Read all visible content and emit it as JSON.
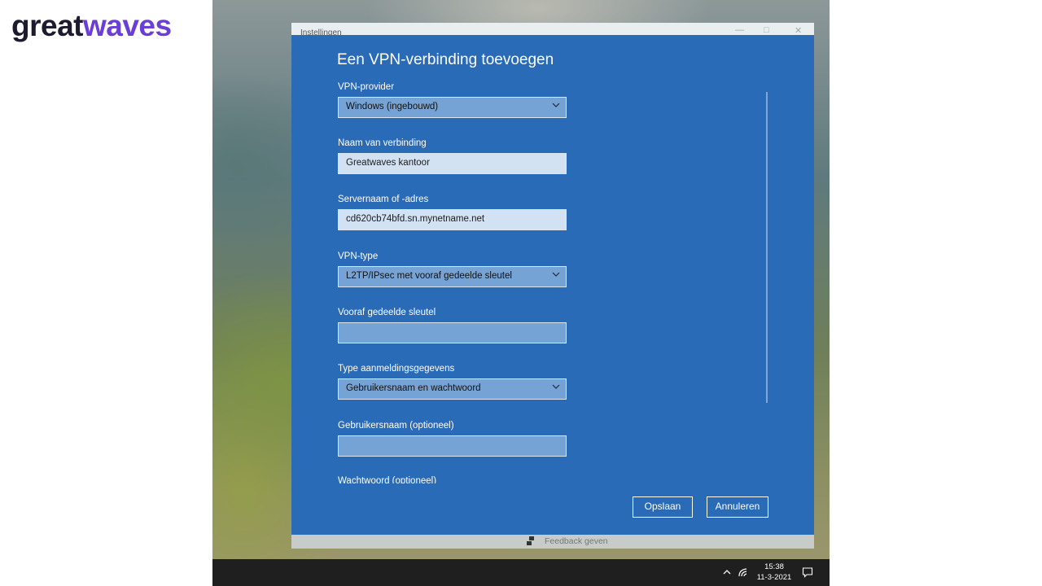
{
  "brand": {
    "part1": "great",
    "part2": "waves"
  },
  "window": {
    "title": "Instellingen"
  },
  "dialog": {
    "title": "Een VPN-verbinding toevoegen",
    "fields": [
      {
        "label": "VPN-provider",
        "value": "Windows (ingebouwd)",
        "type": "select"
      },
      {
        "label": "Naam van verbinding",
        "value": "Greatwaves kantoor",
        "type": "text"
      },
      {
        "label": "Servernaam of -adres",
        "value": "cd620cb74bfd.sn.mynetname.net",
        "type": "text"
      },
      {
        "label": "VPN-type",
        "value": "L2TP/IPsec met vooraf gedeelde sleutel",
        "type": "select"
      },
      {
        "label": "Vooraf gedeelde sleutel",
        "value": "",
        "type": "password"
      },
      {
        "label": "Type aanmeldingsgegevens",
        "value": "Gebruikersnaam en wachtwoord",
        "type": "select"
      },
      {
        "label": "Gebruikersnaam (optioneel)",
        "value": "",
        "type": "text"
      }
    ],
    "partial_label": "Wachtwoord (optioneel)",
    "save_label": "Opslaan",
    "cancel_label": "Annuleren"
  },
  "feedback_label": "Feedback geven",
  "taskbar": {
    "time": "15:38",
    "date": "11-3-2021"
  },
  "colors": {
    "dialog_bg": "#2a6bb8",
    "brand_accent": "#6a3fd8"
  },
  "icons": [
    "chevron-down-icon",
    "feedback-icon",
    "chevron-up-icon",
    "wifi-icon",
    "notification-icon"
  ]
}
